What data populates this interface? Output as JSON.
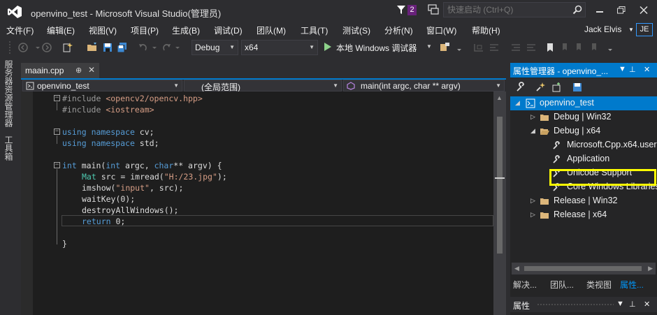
{
  "window": {
    "title": "openvino_test - Microsoft Visual Studio(管理员)",
    "notification_count": "2",
    "quick_launch_placeholder": "快速启动 (Ctrl+Q)"
  },
  "menu": {
    "items": [
      "文件(F)",
      "编辑(E)",
      "视图(V)",
      "项目(P)",
      "生成(B)",
      "调试(D)",
      "团队(M)",
      "工具(T)",
      "测试(S)",
      "分析(N)",
      "窗口(W)",
      "帮助(H)"
    ],
    "user_name": "Jack Elvis",
    "user_initials": "JE"
  },
  "toolbar": {
    "config": "Debug",
    "platform": "x64",
    "run_label": "本地 Windows 调试器"
  },
  "side_tabs": [
    "服务器资源管理器",
    "工具箱"
  ],
  "editor": {
    "tab_name": "maain.cpp",
    "tab_pin": "⊕",
    "nav_project": "openvino_test",
    "nav_scope": "(全局范围)",
    "nav_member": "main(int argc, char ** argv)",
    "code": {
      "l1_pp": "#include ",
      "l1_str": "<opencv2/opencv.hpp>",
      "l2_pp": "#include ",
      "l2_str": "<iostream>",
      "l4_kw1": "using",
      "l4_kw2": "namespace",
      "l4_rest": " cv;",
      "l5_kw1": "using",
      "l5_kw2": "namespace",
      "l5_rest": " std;",
      "l7_kw": "int",
      "l7_a": " main(",
      "l7_kw2": "int",
      "l7_b": " argc, ",
      "l7_kw3": "char",
      "l7_c": "** argv) {",
      "l8_ty": "Mat",
      "l8_a": " src = imread(",
      "l8_str": "\"H:/23.jpg\"",
      "l8_b": ");",
      "l9_a": "imshow(",
      "l9_str": "\"input\"",
      "l9_b": ", src);",
      "l10": "waitKey(0);",
      "l11": "destroyAllWindows();",
      "l12_kw": "return",
      "l12_rest": " 0;",
      "l14": "}"
    }
  },
  "property_manager": {
    "title": "属性管理器 - openvino_...",
    "tree": {
      "root": "openvino_test",
      "debug_win32": "Debug | Win32",
      "debug_x64": "Debug | x64",
      "ms_cpp": "Microsoft.Cpp.x64.user",
      "application": "Application",
      "unicode": "Unicode Support",
      "core_libs": "Core Windows Libraries",
      "release_win32": "Release | Win32",
      "release_x64": "Release | x64"
    },
    "bottom_tabs": [
      "解决...",
      "团队...",
      "类视图",
      "属性..."
    ],
    "properties_title": "属性"
  },
  "colors": {
    "accent": "#007acc",
    "highlight": "#ffff00",
    "background": "#2d2d30",
    "editor_bg": "#1e1e1e"
  }
}
